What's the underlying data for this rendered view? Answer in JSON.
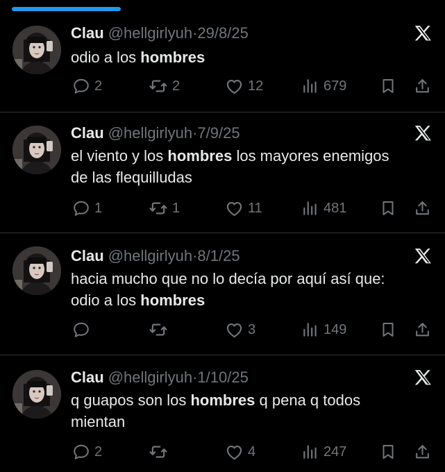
{
  "colors": {
    "background": "#000000",
    "accent": "#1d9bf0",
    "muted": "#71767b",
    "text": "#e7e9ea",
    "divider": "#2f3336"
  },
  "icons": {
    "reply": "reply-icon",
    "retweet": "retweet-icon",
    "like": "heart-icon",
    "views": "views-icon",
    "bookmark": "bookmark-icon",
    "share": "share-icon",
    "x_logo": "x-logo-icon"
  },
  "tweets": [
    {
      "name": "Clau",
      "handle": "@hellgirlyuh",
      "separator": "·",
      "date": "29/8/25",
      "line1": {
        "pre": "odio a los ",
        "bold": "hombres",
        "post": ""
      },
      "line2": {
        "pre": "",
        "bold": "",
        "post": ""
      },
      "replies": "2",
      "retweets": "2",
      "likes": "12",
      "views": "679"
    },
    {
      "name": "Clau",
      "handle": "@hellgirlyuh",
      "separator": "·",
      "date": "7/9/25",
      "line1": {
        "pre": "el viento y los ",
        "bold": "hombres",
        "post": " los mayores enemigos"
      },
      "line2": {
        "pre": "de las flequilludas",
        "bold": "",
        "post": ""
      },
      "replies": "1",
      "retweets": "1",
      "likes": "11",
      "views": "481"
    },
    {
      "name": "Clau",
      "handle": "@hellgirlyuh",
      "separator": "·",
      "date": "8/1/25",
      "line1": {
        "pre": "hacia mucho que no lo decía por aquí así que:",
        "bold": "",
        "post": ""
      },
      "line2": {
        "pre": "odio a los ",
        "bold": "hombres",
        "post": ""
      },
      "replies": "",
      "retweets": "",
      "likes": "3",
      "views": "149"
    },
    {
      "name": "Clau",
      "handle": "@hellgirlyuh",
      "separator": "·",
      "date": "1/10/25",
      "line1": {
        "pre": "q guapos son los ",
        "bold": "hombres",
        "post": " q pena q todos"
      },
      "line2": {
        "pre": "mientan",
        "bold": "",
        "post": ""
      },
      "replies": "2",
      "retweets": "",
      "likes": "4",
      "views": "247"
    }
  ]
}
